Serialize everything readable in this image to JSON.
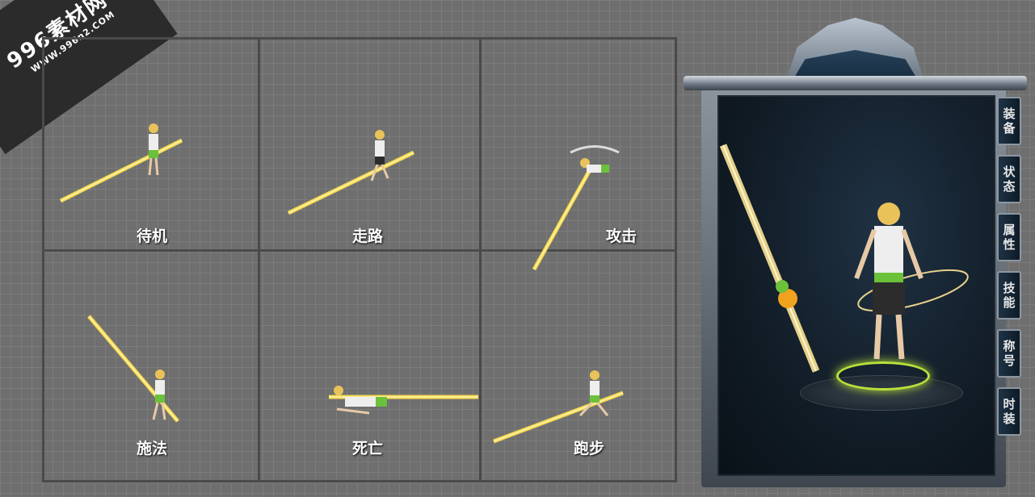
{
  "watermark": {
    "main": "996素材网",
    "sub": "WWW.996n2.COM"
  },
  "animations": [
    {
      "label": "待机"
    },
    {
      "label": "走路"
    },
    {
      "label": "攻击"
    },
    {
      "label": "施法"
    },
    {
      "label": "死亡"
    },
    {
      "label": "跑步"
    }
  ],
  "panel_tabs": [
    {
      "chars": [
        "装",
        "备"
      ]
    },
    {
      "chars": [
        "状",
        "态"
      ]
    },
    {
      "chars": [
        "属",
        "性"
      ]
    },
    {
      "chars": [
        "技",
        "能"
      ]
    },
    {
      "chars": [
        "称",
        "号"
      ]
    },
    {
      "chars": [
        "时",
        "装"
      ]
    }
  ],
  "colors": {
    "glow": "#e8d44a",
    "accent": "#b8e23a",
    "panel_dark": "#0f1c28"
  }
}
